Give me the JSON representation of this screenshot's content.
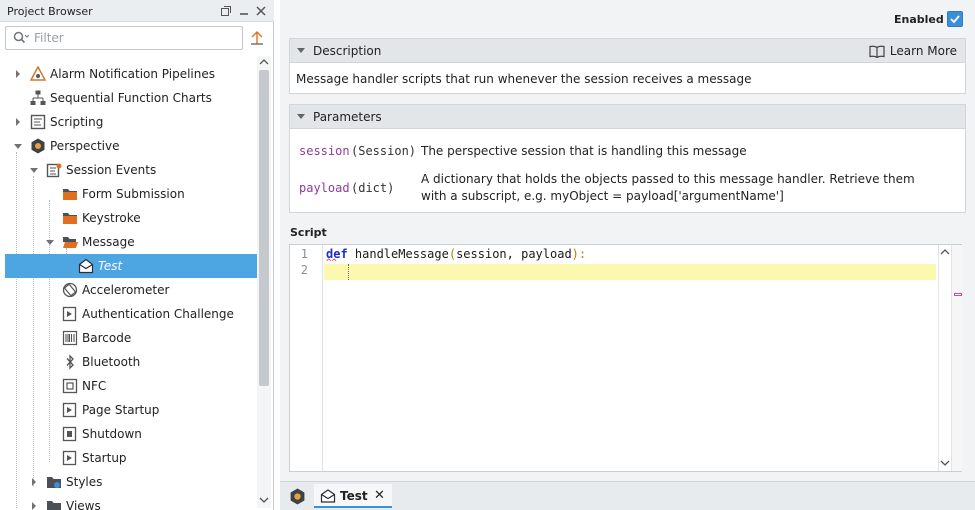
{
  "browser": {
    "title": "Project Browser",
    "filter_placeholder": "Filter",
    "tree": [
      {
        "label": "Alarm Notification Pipelines",
        "icon": "alarm-pipeline-icon"
      },
      {
        "label": "Sequential Function Charts",
        "icon": "sfc-icon"
      },
      {
        "label": "Scripting",
        "icon": "scripting-icon"
      },
      {
        "label": "Perspective",
        "icon": "perspective-icon"
      },
      {
        "label": "Session Events",
        "icon": "session-events-icon"
      },
      {
        "label": "Form Submission",
        "icon": "folder-icon"
      },
      {
        "label": "Keystroke",
        "icon": "folder-icon"
      },
      {
        "label": "Message",
        "icon": "folder-open-icon"
      },
      {
        "label": "Test",
        "icon": "message-handler-icon"
      },
      {
        "label": "Accelerometer",
        "icon": "accelerometer-icon"
      },
      {
        "label": "Authentication Challenge",
        "icon": "script-event-icon"
      },
      {
        "label": "Barcode",
        "icon": "barcode-icon"
      },
      {
        "label": "Bluetooth",
        "icon": "bluetooth-icon"
      },
      {
        "label": "NFC",
        "icon": "nfc-icon"
      },
      {
        "label": "Page Startup",
        "icon": "script-event-icon"
      },
      {
        "label": "Shutdown",
        "icon": "script-event-icon"
      },
      {
        "label": "Startup",
        "icon": "script-event-icon"
      },
      {
        "label": "Styles",
        "icon": "styles-icon"
      },
      {
        "label": "Views",
        "icon": "views-icon"
      }
    ]
  },
  "editor": {
    "enabled_label": "Enabled",
    "enabled": true,
    "description": {
      "title": "Description",
      "learn_more": "Learn More",
      "text": "Message handler scripts that run whenever the session receives a message"
    },
    "parameters": {
      "title": "Parameters",
      "items": [
        {
          "name": "session",
          "type": "(Session)",
          "desc": "The perspective session that is handling this message"
        },
        {
          "name": "payload",
          "type": "(dict)",
          "desc": "A dictionary that holds the objects passed to this message handler. Retrieve them with a subscript, e.g. myObject = payload['argumentName']"
        }
      ]
    },
    "script": {
      "label": "Script",
      "line_numbers": [
        "1",
        "2"
      ],
      "keyword": "def",
      "signature": " handleMessage",
      "open_paren": "(",
      "args": "session, payload",
      "close": "):",
      "squiggle": "^^"
    }
  },
  "tabs": {
    "active_label": "Test",
    "close_glyph": "✕"
  },
  "colors": {
    "selection": "#4da6e1",
    "accent": "#3b8fd6",
    "keyword": "#1b2ec8",
    "param_name": "#8a3e9a",
    "current_line": "#fbf8b0"
  }
}
